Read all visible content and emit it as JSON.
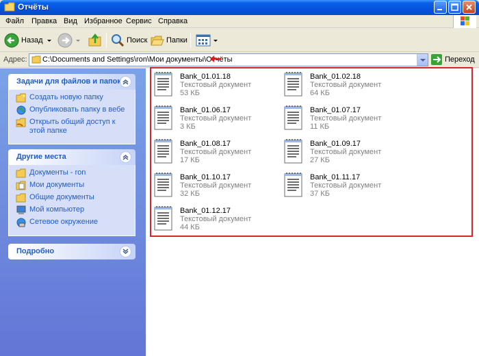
{
  "window": {
    "title": "Отчёты"
  },
  "menu": [
    "Файл",
    "Правка",
    "Вид",
    "Избранное",
    "Сервис",
    "Справка"
  ],
  "toolbar": {
    "back_label": "Назад",
    "search_label": "Поиск",
    "folders_label": "Папки"
  },
  "address": {
    "label": "Адрес:",
    "path": "C:\\Documents and Settings\\ron\\Мои документы\\Отчёты",
    "go_label": "Переход"
  },
  "tasks_panel": {
    "title": "Задачи для файлов и папок",
    "items": [
      {
        "label": "Создать новую папку",
        "icon": "new-folder-icon"
      },
      {
        "label": "Опубликовать папку в вебе",
        "icon": "globe-icon"
      },
      {
        "label": "Открыть общий доступ к этой папке",
        "icon": "share-folder-icon"
      }
    ]
  },
  "places_panel": {
    "title": "Другие места",
    "items": [
      {
        "label": "Документы - ron",
        "icon": "folder-icon"
      },
      {
        "label": "Мои документы",
        "icon": "my-documents-icon"
      },
      {
        "label": "Общие документы",
        "icon": "folder-icon"
      },
      {
        "label": "Мой компьютер",
        "icon": "computer-icon"
      },
      {
        "label": "Сетевое окружение",
        "icon": "network-icon"
      }
    ]
  },
  "details_panel": {
    "title": "Подробно"
  },
  "files": [
    {
      "name": "Bank_01.01.18",
      "type": "Текстовый документ",
      "size": "53 КБ"
    },
    {
      "name": "Bank_01.02.18",
      "type": "Текстовый документ",
      "size": "64 КБ"
    },
    {
      "name": "Bank_01.06.17",
      "type": "Текстовый документ",
      "size": "3 КБ"
    },
    {
      "name": "Bank_01.07.17",
      "type": "Текстовый документ",
      "size": "11 КБ"
    },
    {
      "name": "Bank_01.08.17",
      "type": "Текстовый документ",
      "size": "17 КБ"
    },
    {
      "name": "Bank_01.09.17",
      "type": "Текстовый документ",
      "size": "27 КБ"
    },
    {
      "name": "Bank_01.10.17",
      "type": "Текстовый документ",
      "size": "32 КБ"
    },
    {
      "name": "Bank_01.11.17",
      "type": "Текстовый документ",
      "size": "37 КБ"
    },
    {
      "name": "Bank_01.12.17",
      "type": "Текстовый документ",
      "size": "44 КБ"
    }
  ],
  "colors": {
    "titlebar": "#0553e0",
    "highlight_box": "#d6242e",
    "link": "#215dc6"
  }
}
